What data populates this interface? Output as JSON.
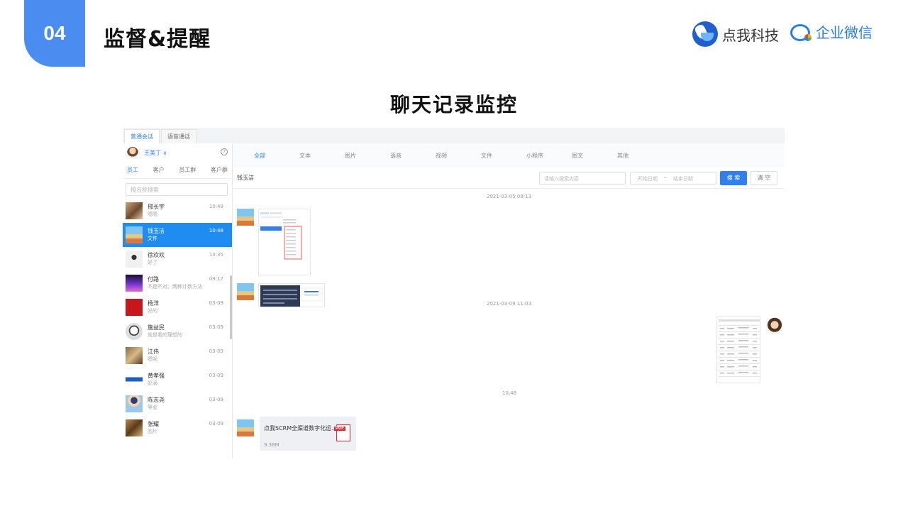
{
  "slide": {
    "number": "04",
    "title": "监督&提醒",
    "brand1": "点我科技",
    "brand2": "企业微信",
    "center_title": "聊天记录监控"
  },
  "app": {
    "top_tabs": [
      "普通会话",
      "语音通话"
    ],
    "user": {
      "name": "王美丁 ∨"
    },
    "sub_tabs": [
      "员工",
      "客户",
      "员工群",
      "客户群"
    ],
    "search_placeholder": "按名称搜索",
    "contacts": [
      {
        "name": "邢长宇",
        "sub": "嗯嗯",
        "time": "10:49"
      },
      {
        "name": "钱玉洁",
        "sub": "文件",
        "time": "10:48"
      },
      {
        "name": "徐欢欢",
        "sub": "好了",
        "time": "10:35"
      },
      {
        "name": "付路",
        "sub": "不是不对。两种计数方法",
        "time": "09:17"
      },
      {
        "name": "杨洋",
        "sub": "好的",
        "time": "03-09"
      },
      {
        "name": "施益民",
        "sub": "就是看的理想的",
        "time": "03-09"
      },
      {
        "name": "江伟",
        "sub": "嗯呢",
        "time": "03-09"
      },
      {
        "name": "黄孝强",
        "sub": "好滴",
        "time": "03-09"
      },
      {
        "name": "陈志尧",
        "sub": "等会",
        "time": "03-09"
      },
      {
        "name": "张耀",
        "sub": "图片",
        "time": "03-09"
      }
    ],
    "type_tabs": [
      "全部",
      "文本",
      "图片",
      "语音",
      "视频",
      "文件",
      "小程序",
      "图文",
      "其他"
    ],
    "chat_name": "钱玉洁",
    "keyword_placeholder": "请输入搜索内容",
    "date_start": "开始日期",
    "date_sep": "~",
    "date_end": "结束日期",
    "search_btn": "搜 索",
    "clear_btn": "清 空",
    "timestamps": [
      "2021-03-05 09:13",
      "2021-03-09 11:03",
      "10:48"
    ],
    "file_msg": {
      "name": "点我SCRM全渠道数字化运...",
      "size": "9.38M",
      "badge": "PDF"
    }
  },
  "colors": {
    "accent": "#2f7ff2",
    "slide_tab": "#4a8cf0",
    "active_row": "#1e8cf0"
  }
}
